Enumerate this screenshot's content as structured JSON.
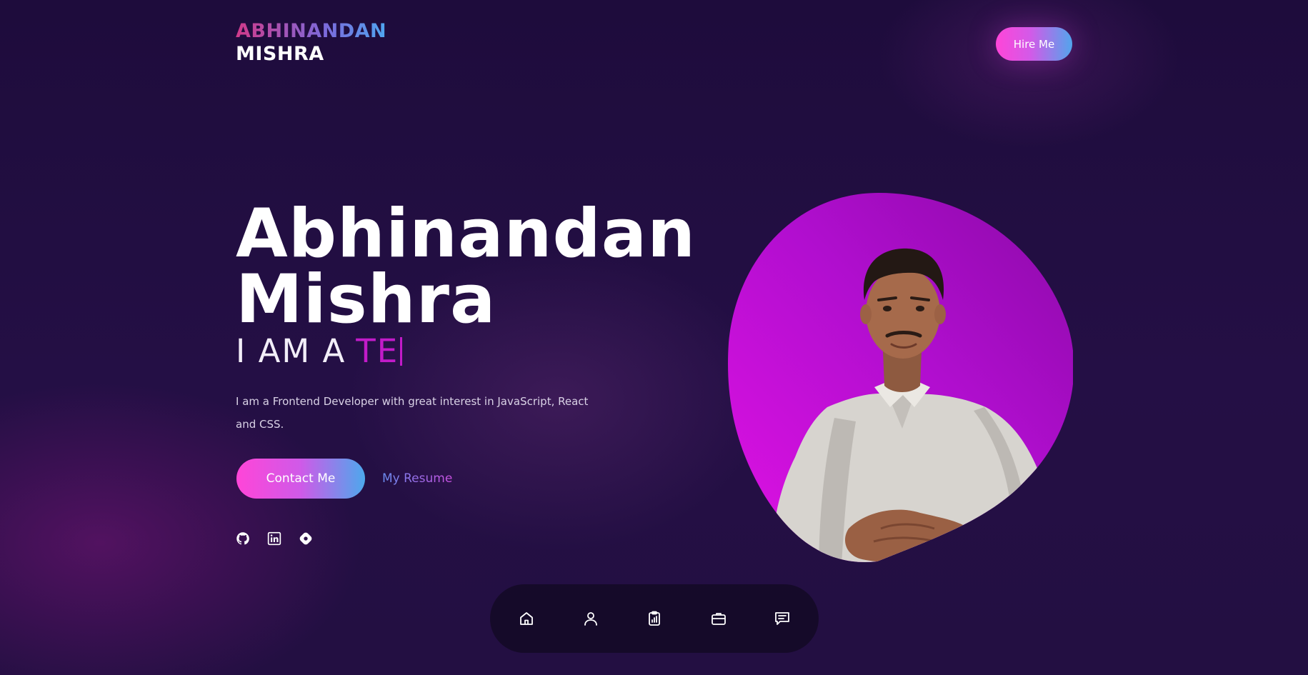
{
  "header": {
    "logo_first": "ABHINANDAN",
    "logo_last": "MISHRA",
    "hire_label": "Hire Me"
  },
  "hero": {
    "name_line1": "Abhinandan",
    "name_line2": "Mishra",
    "tagline_prefix": "I AM A",
    "tagline_typed": "TE",
    "intro": "I am a Frontend Developer with great interest in JavaScript, React and CSS.",
    "contact_label": "Contact Me",
    "resume_label": "My Resume"
  },
  "socials": [
    {
      "icon": "github-icon"
    },
    {
      "icon": "linkedin-icon"
    },
    {
      "icon": "hashnode-icon"
    }
  ],
  "bottom_nav": [
    {
      "icon": "home-icon"
    },
    {
      "icon": "user-icon"
    },
    {
      "icon": "clipboard-chart-icon"
    },
    {
      "icon": "briefcase-icon"
    },
    {
      "icon": "chat-icon"
    }
  ],
  "colors": {
    "background": "#1f0d3e",
    "accent_pink": "#ff45d8",
    "accent_blue": "#4da8ec",
    "typed_text": "#c21bc9",
    "blob": "#a20fbf"
  }
}
